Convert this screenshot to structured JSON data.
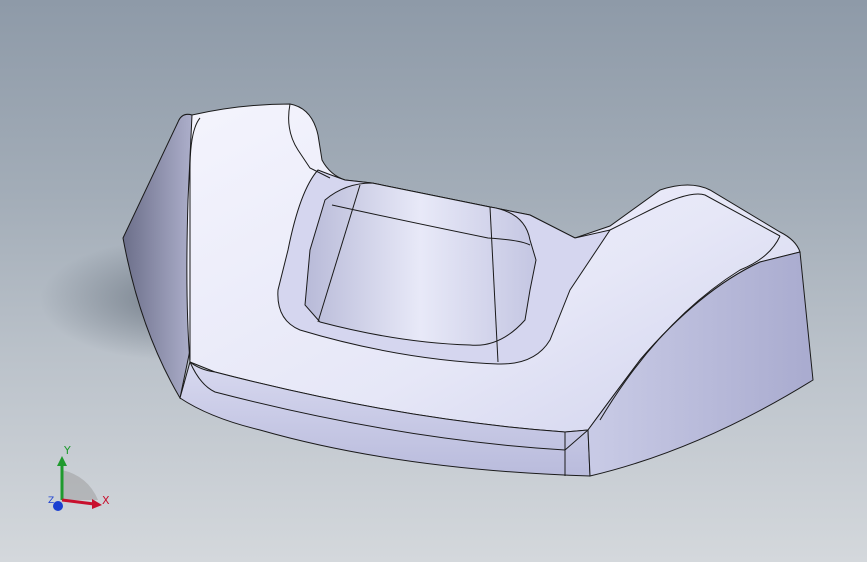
{
  "viewport": {
    "background_top": "#8e9aa8",
    "background_bottom": "#d4d8dc",
    "model_face_color": "#dfe0f4",
    "model_edge_color": "#1a1a1a"
  },
  "triad": {
    "x_label": "X",
    "y_label": "Y",
    "z_label": "Z",
    "x_color": "#c8102e",
    "y_color": "#1f9a2e",
    "z_color": "#1a3fd1"
  }
}
